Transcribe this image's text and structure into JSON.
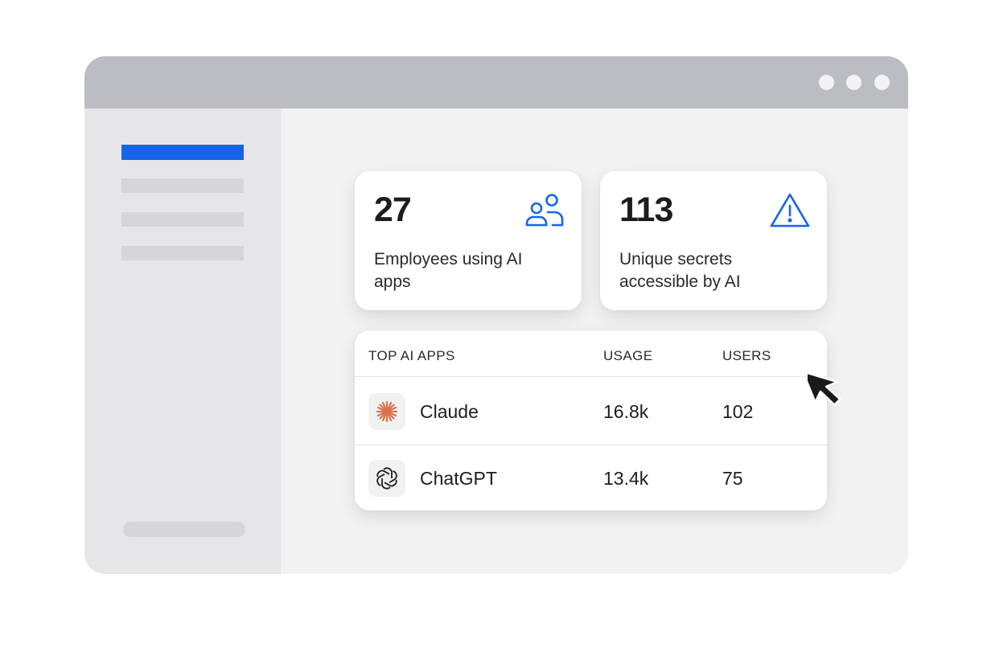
{
  "window": {
    "controls": [
      "window-dot",
      "window-dot",
      "window-dot"
    ]
  },
  "stats": [
    {
      "value": "27",
      "label": "Employees using AI apps",
      "icon": "users-icon"
    },
    {
      "value": "113",
      "label": "Unique secrets accessible by AI",
      "icon": "warning-icon"
    }
  ],
  "table": {
    "headers": {
      "app": "TOP AI APPS",
      "usage": "USAGE",
      "users": "USERS"
    },
    "rows": [
      {
        "name": "Claude",
        "usage": "16.8k",
        "users": "102",
        "icon": "claude-icon"
      },
      {
        "name": "ChatGPT",
        "usage": "13.4k",
        "users": "75",
        "icon": "chatgpt-icon"
      }
    ]
  },
  "colors": {
    "accent": "#1764e8",
    "claude": "#d9734e",
    "titlebar": "#bcbdc3"
  }
}
